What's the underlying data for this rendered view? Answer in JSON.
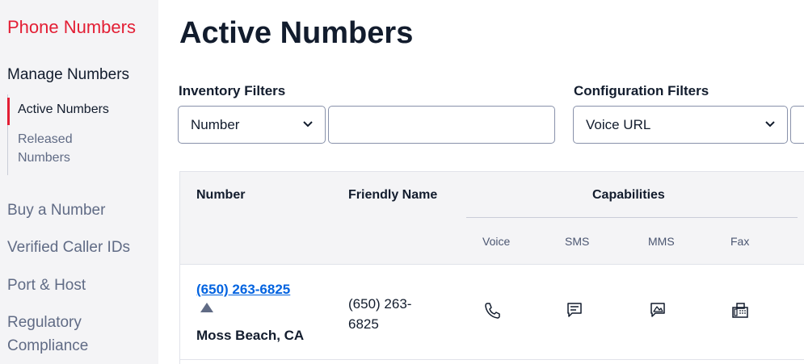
{
  "sidebar": {
    "title": "Phone Numbers",
    "section": "Manage Numbers",
    "sub_items": [
      "Active Numbers",
      "Released Numbers"
    ],
    "items": [
      "Buy a Number",
      "Verified Caller IDs",
      "Port & Host",
      "Regulatory Compliance"
    ]
  },
  "main": {
    "title": "Active Numbers",
    "inventory_filters": {
      "label": "Inventory Filters",
      "select_value": "Number",
      "input_value": ""
    },
    "configuration_filters": {
      "label": "Configuration Filters",
      "select_value": "Voice URL"
    }
  },
  "table": {
    "headers": {
      "number": "Number",
      "friendly_name": "Friendly Name",
      "capabilities": "Capabilities"
    },
    "capability_columns": [
      "Voice",
      "SMS",
      "MMS",
      "Fax"
    ],
    "rows": [
      {
        "number": "(650) 263-6825",
        "location": "Moss Beach, CA",
        "friendly_name": "(650) 263-6825",
        "capability_icons": [
          "phone-icon",
          "sms-icon",
          "mms-icon",
          "fax-icon"
        ]
      }
    ]
  },
  "colors": {
    "brand_red": "#e31e34",
    "link_blue": "#0263e0",
    "text": "#121c2d",
    "muted": "#606b85",
    "sidebar_bg": "#f4f4f6"
  }
}
